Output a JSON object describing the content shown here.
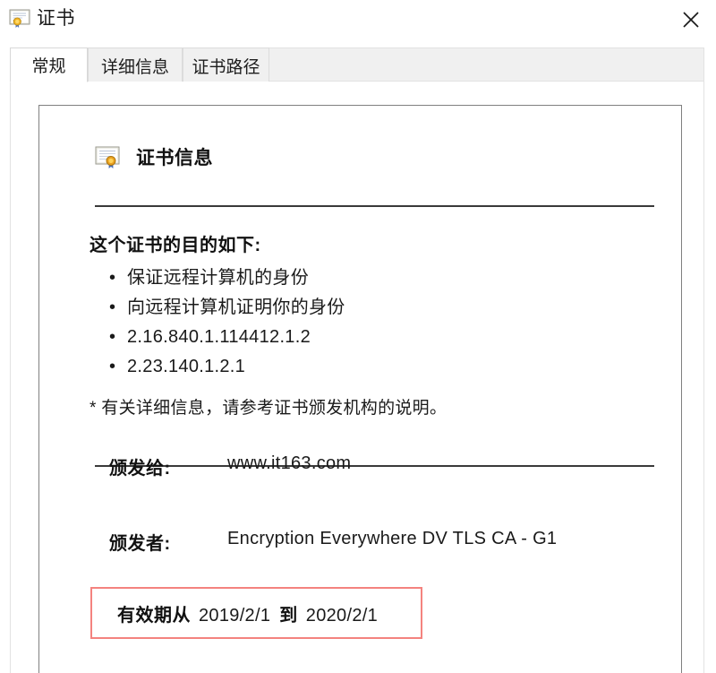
{
  "window": {
    "title": "证书",
    "icon": "certificate-icon",
    "close_label": "✕"
  },
  "tabs": [
    {
      "label": "常规",
      "active": true
    },
    {
      "label": "详细信息",
      "active": false
    },
    {
      "label": "证书路径",
      "active": false
    }
  ],
  "card": {
    "header_icon": "certificate-icon",
    "header_title": "证书信息",
    "purpose_title": "这个证书的目的如下:",
    "purposes": [
      "保证远程计算机的身份",
      "向远程计算机证明你的身份",
      "2.16.840.1.114412.1.2",
      "2.23.140.1.2.1"
    ],
    "footnote": "* 有关详细信息，请参考证书颁发机构的说明。",
    "fields": [
      {
        "label": "颁发给:",
        "value": "www.it163.com"
      },
      {
        "label": "颁发者:",
        "value": "Encryption Everywhere DV TLS CA - G1"
      }
    ],
    "validity": {
      "label": "有效期从",
      "valid_from": "2019/2/1",
      "to_label": "到",
      "valid_to": "2020/2/1",
      "highlight_color": "#f4837f"
    }
  }
}
